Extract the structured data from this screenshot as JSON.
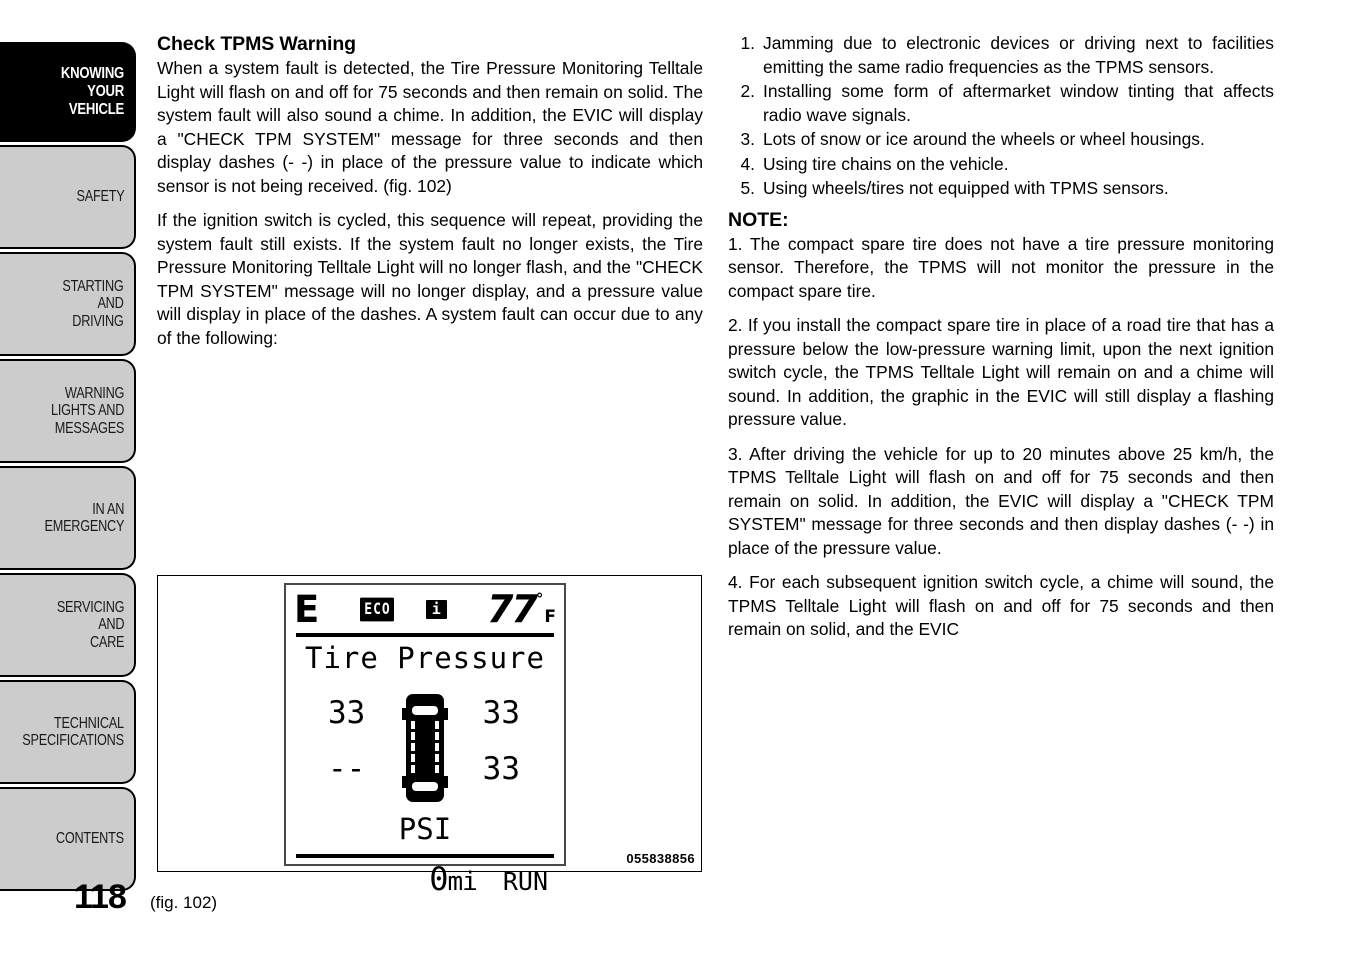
{
  "sidebar": {
    "items": [
      {
        "label": "KNOWING\nYOUR\nVEHICLE",
        "active": true
      },
      {
        "label": "SAFETY",
        "active": false
      },
      {
        "label": "STARTING\nAND\nDRIVING",
        "active": false
      },
      {
        "label": "WARNING\nLIGHTS AND\nMESSAGES",
        "active": false
      },
      {
        "label": "IN AN\nEMERGENCY",
        "active": false
      },
      {
        "label": "SERVICING\nAND\nCARE",
        "active": false
      },
      {
        "label": "TECHNICAL\nSPECIFICATIONS",
        "active": false
      },
      {
        "label": "CONTENTS",
        "active": false
      }
    ]
  },
  "page_number": "118",
  "left_column": {
    "heading": "Check TPMS Warning",
    "paragraph_1": "When a system fault is detected, the Tire Pressure Monitoring Telltale Light will flash on and off for 75 seconds and then remain on solid. The system fault will also sound a chime. In addition, the EVIC will display a \"CHECK TPM SYSTEM\" message for three seconds and then display dashes (- -) in place of the pressure value to indicate which sensor is not being received. (fig. 102)",
    "paragraph_2": "If the ignition switch is cycled, this sequence will repeat, providing the system fault still exists. If the system fault no longer exists, the Tire Pressure Monitoring Telltale Light will no longer flash, and the \"CHECK TPM SYSTEM\" message will no longer display, and a pressure value will display in place of the dashes. A system fault can occur due to any of the following:"
  },
  "right_column": {
    "causes": [
      {
        "num": "1.",
        "text": "Jamming due to electronic devices or driving next to facilities emitting the same radio frequencies as the TPMS sensors."
      },
      {
        "num": "2.",
        "text": "Installing some form of aftermarket window tinting that affects radio wave signals."
      },
      {
        "num": "3.",
        "text": "Lots of snow or ice around the wheels or wheel housings."
      },
      {
        "num": "4.",
        "text": "Using tire chains on the vehicle."
      },
      {
        "num": "5.",
        "text": "Using wheels/tires not equipped with TPMS sensors."
      }
    ],
    "note_heading": "NOTE:",
    "notes": [
      "1.  The compact spare tire does not have a tire pressure monitoring sensor. Therefore, the TPMS will not monitor the pressure in the compact spare tire.",
      "2.  If you install the compact spare tire in place of a road tire that has a pressure below the low-pressure warning limit, upon the next ignition switch cycle, the TPMS Telltale Light will remain on and a chime will sound. In addition, the graphic in the EVIC will still display a flashing pressure value.",
      "3.  After driving the vehicle for up to 20 minutes above 25 km/h, the TPMS Telltale Light will flash on and off for 75 seconds and then remain on solid. In addition, the EVIC will display a \"CHECK TPM SYSTEM\" message for three seconds and then display dashes (- -) in place of the pressure value.",
      "4.  For each subsequent ignition switch cycle, a chime will sound, the TPMS Telltale Light will flash on and off for 75 seconds and then remain on solid, and the EVIC"
    ]
  },
  "figure": {
    "caption": "(fig. 102)",
    "id_code": "055838856",
    "evic": {
      "fuel_letter": "E",
      "eco_badge": "ECO",
      "info_badge": "i",
      "temperature_value": "77",
      "temperature_degree": "°",
      "temperature_unit": "F",
      "title": "Tire Pressure",
      "pressure_front_left": "33",
      "pressure_front_right": "33",
      "pressure_rear_left": "--",
      "pressure_rear_right": "33",
      "pressure_unit": "PSI",
      "odometer_value": "0",
      "odometer_unit": "mi",
      "gear_status": "RUN"
    }
  },
  "colors": {
    "tab_gray": "#cccccc",
    "tab_active": "#000000",
    "text": "#000000",
    "page_background": "#ffffff"
  }
}
